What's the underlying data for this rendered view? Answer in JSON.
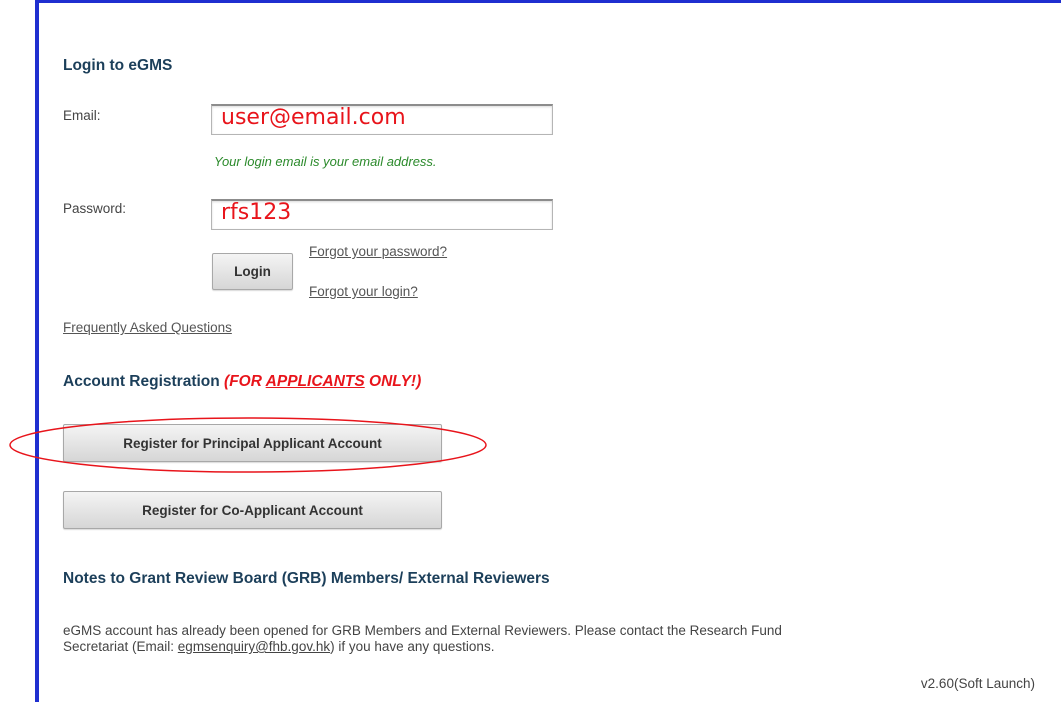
{
  "login": {
    "title": "Login to eGMS",
    "email_label": "Email:",
    "email_value": "user@email.com",
    "email_hint": "Your login email is your email address.",
    "password_label": "Password:",
    "password_value": "rfs123",
    "login_button": "Login",
    "forgot_password": "Forgot your password?",
    "forgot_login": "Forgot your login?"
  },
  "faq_link": "Frequently Asked Questions",
  "registration": {
    "title": "Account Registration",
    "note_prefix": "(FOR ",
    "note_emphasis": "APPLICANTS",
    "note_suffix": " ONLY!)",
    "principal_button": "Register for Principal Applicant Account",
    "co_button": "Register for Co-Applicant Account"
  },
  "notes": {
    "title": "Notes to Grant Review Board (GRB) Members/ External Reviewers",
    "body_line1": "eGMS account has already been opened for GRB Members and External Reviewers. Please contact the Research Fund",
    "body_line2_prefix": "Secretariat (Email: ",
    "email_link": "egmsenquiry@fhb.gov.hk",
    "body_line2_suffix": ") if you have any questions."
  },
  "version": "v2.60(Soft Launch)",
  "colors": {
    "frame_border": "#1f2fd0",
    "heading": "#1c3f5a",
    "annotation_red": "#e8141b",
    "hint_green": "#2b8a2b"
  }
}
